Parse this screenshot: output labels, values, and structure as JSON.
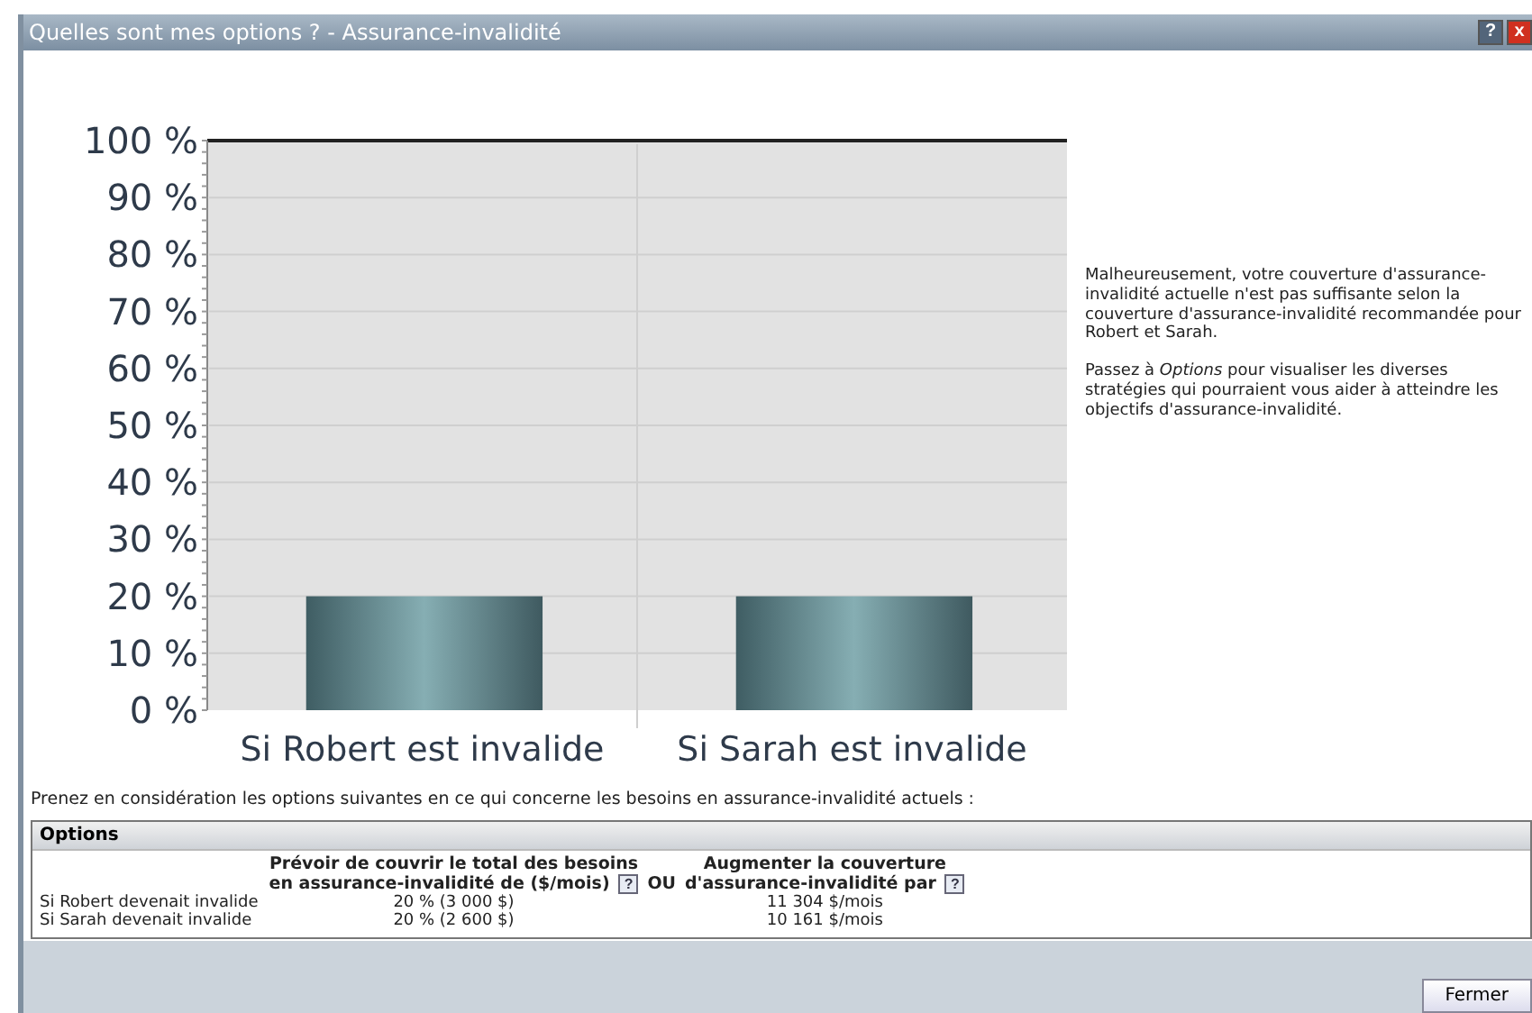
{
  "window": {
    "title": "Quelles sont mes options ? - Assurance-invalidité",
    "help_glyph": "?",
    "close_glyph": "x"
  },
  "chart": {
    "chart_data": {
      "type": "bar",
      "grid": true,
      "categories": [
        "Si Robert est invalide",
        "Si Sarah est invalide"
      ],
      "values": [
        20,
        20
      ],
      "ylim": [
        0,
        100
      ],
      "yticks": [
        {
          "value": 0,
          "label": "0 %"
        },
        {
          "value": 10,
          "label": "10 %"
        },
        {
          "value": 20,
          "label": "20 %"
        },
        {
          "value": 30,
          "label": "30 %"
        },
        {
          "value": 40,
          "label": "40 %"
        },
        {
          "value": 50,
          "label": "50 %"
        },
        {
          "value": 60,
          "label": "60 %"
        },
        {
          "value": 70,
          "label": "70 %"
        },
        {
          "value": 80,
          "label": "80 %"
        },
        {
          "value": 90,
          "label": "90 %"
        },
        {
          "value": 100,
          "label": "100 %"
        }
      ]
    }
  },
  "message": [
    "Malheureusement, votre couverture d'assurance-invalidité actuelle n'est pas suffisante selon la couverture d'assurance-invalidité recommandée pour Robert et Sarah.",
    "Passez à *Options* pour visualiser les diverses stratégies qui pourraient vous aider à atteindre les objectifs d'assurance-invalidité."
  ],
  "intro": "Prenez en considération les options suivantes en ce qui concerne les besoins en assurance-invalidité actuels :",
  "options": {
    "title": "Options",
    "columns": [
      {
        "lines": [
          "Prévoir de couvrir le total des besoins",
          "en assurance-invalidité de ($/mois)"
        ],
        "help": "?"
      },
      {
        "lines": [
          "Augmenter la couverture",
          "d'assurance-invalidité par"
        ],
        "help": "?"
      }
    ],
    "separator": "OU",
    "rows": [
      {
        "label": "Si Robert devenait invalide",
        "values": [
          "20 % (3 000 $)",
          "11 304 $/mois"
        ]
      },
      {
        "label": "Si Sarah devenait invalide",
        "values": [
          "20 % (2 600 $)",
          "10 161 $/mois"
        ]
      }
    ]
  },
  "buttons": [
    "Fermer"
  ]
}
